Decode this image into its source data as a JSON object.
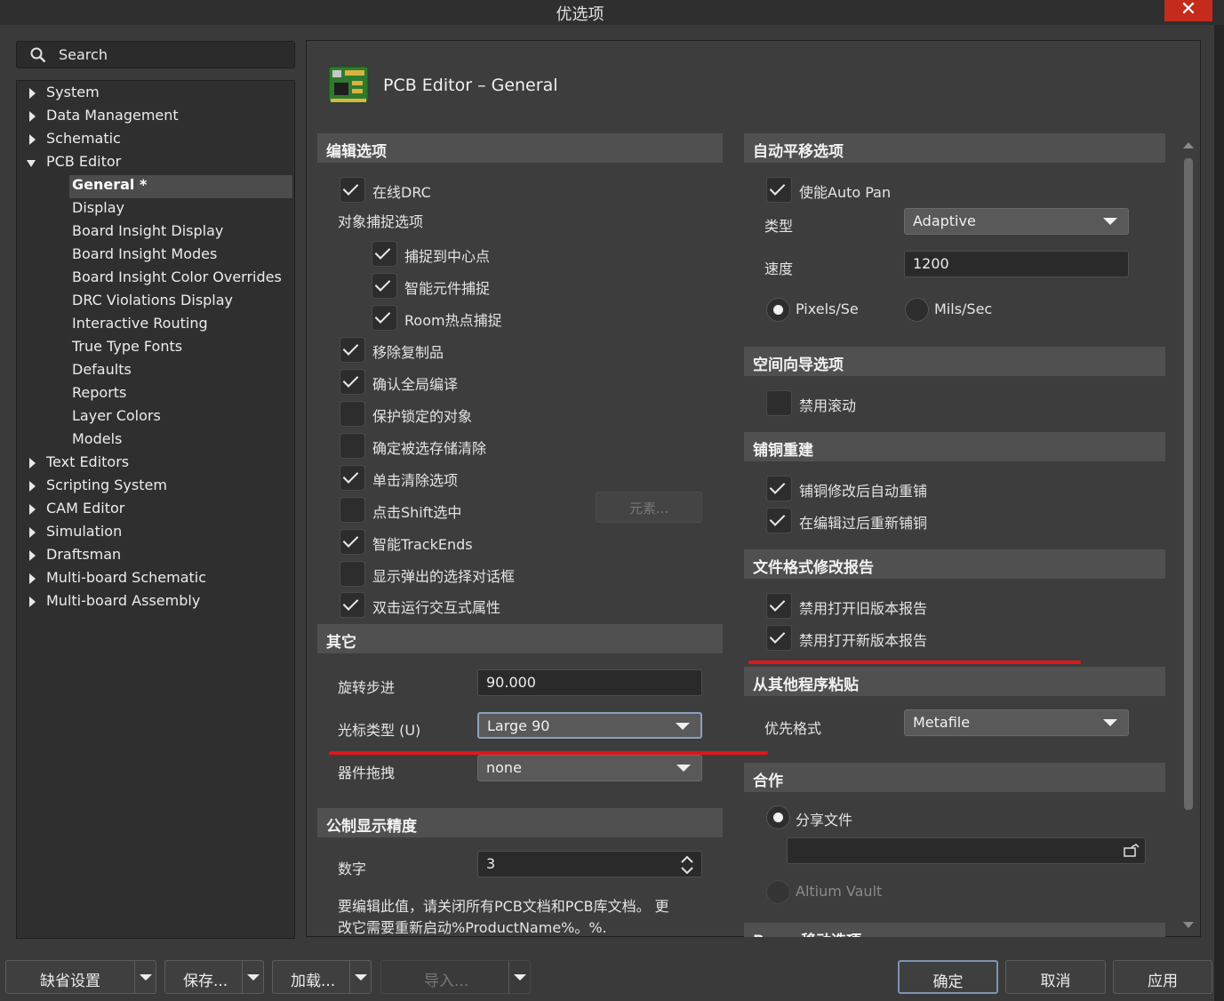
{
  "window": {
    "title": "优选项",
    "close": "✕"
  },
  "search": {
    "placeholder": "Search"
  },
  "tree": {
    "top": [
      "System",
      "Data Management",
      "Schematic",
      "PCB Editor"
    ],
    "pcb_children": [
      "General *",
      "Display",
      "Board Insight Display",
      "Board Insight Modes",
      "Board Insight Color Overrides",
      "DRC Violations Display",
      "Interactive Routing",
      "True Type Fonts",
      "Defaults",
      "Reports",
      "Layer Colors",
      "Models"
    ],
    "bottom": [
      "Text Editors",
      "Scripting System",
      "CAM Editor",
      "Simulation",
      "Draftsman",
      "Multi-board Schematic",
      "Multi-board Assembly"
    ]
  },
  "page": {
    "title": "PCB Editor – General"
  },
  "edit": {
    "header": "编辑选项",
    "online_drc": "在线DRC",
    "snap_header": "对象捕捉选项",
    "snap_center": "捕捉到中心点",
    "smart_comp": "智能元件捕捉",
    "room_hotspot": "Room热点捕捉",
    "remove_dup": "移除复制品",
    "confirm_global": "确认全局编译",
    "protect_locked": "保护锁定的对象",
    "confirm_sel_mem": "确定被选存储清除",
    "click_clear": "单击清除选项",
    "shift_select": "点击Shift选中",
    "elements_btn": "元素...",
    "smart_trackends": "智能TrackEnds",
    "show_popup": "显示弹出的选择对话框",
    "dbl_click": "双击运行交互式属性"
  },
  "other": {
    "header": "其它",
    "rotation_label": "旋转步进",
    "rotation_value": "90.000",
    "cursor_label": "光标类型 (U)",
    "cursor_value": "Large 90",
    "drag_label": "器件拖拽",
    "drag_value": "none"
  },
  "metric": {
    "header": "公制显示精度",
    "digits_label": "数字",
    "digits_value": "3",
    "note_line1": "要编辑此值，请关闭所有PCB文档和PCB库文档。 更",
    "note_line2": "改它需要重新启动%ProductName%。%."
  },
  "autopan": {
    "header": "自动平移选项",
    "enable": "使能Auto Pan",
    "type_label": "类型",
    "type_value": "Adaptive",
    "speed_label": "速度",
    "speed_value": "1200",
    "pixels": "Pixels/Se",
    "mils": "Mils/Sec"
  },
  "space_nav": {
    "header": "空间向导选项",
    "disable_roll": "禁用滚动"
  },
  "pour": {
    "header": "铺铜重建",
    "auto_repour": "铺铜修改后自动重铺",
    "repour_after_edit": "在编辑过后重新铺铜"
  },
  "file_format": {
    "header": "文件格式修改报告",
    "disable_old": "禁用打开旧版本报告",
    "disable_new": "禁用打开新版本报告"
  },
  "paste": {
    "header": "从其他程序粘贴",
    "pref_label": "优先格式",
    "pref_value": "Metafile"
  },
  "collab": {
    "header": "合作",
    "share_file": "分享文件",
    "vault": "Altium Vault",
    "next_header": "Room移动选项"
  },
  "footer": {
    "defaults": "缺省设置",
    "save": "保存...",
    "load": "加载...",
    "import": "导入...",
    "ok": "确定",
    "cancel": "取消",
    "apply": "应用"
  },
  "colors": {
    "accent_red": "#e0161b",
    "close_red": "#c42b1c"
  }
}
